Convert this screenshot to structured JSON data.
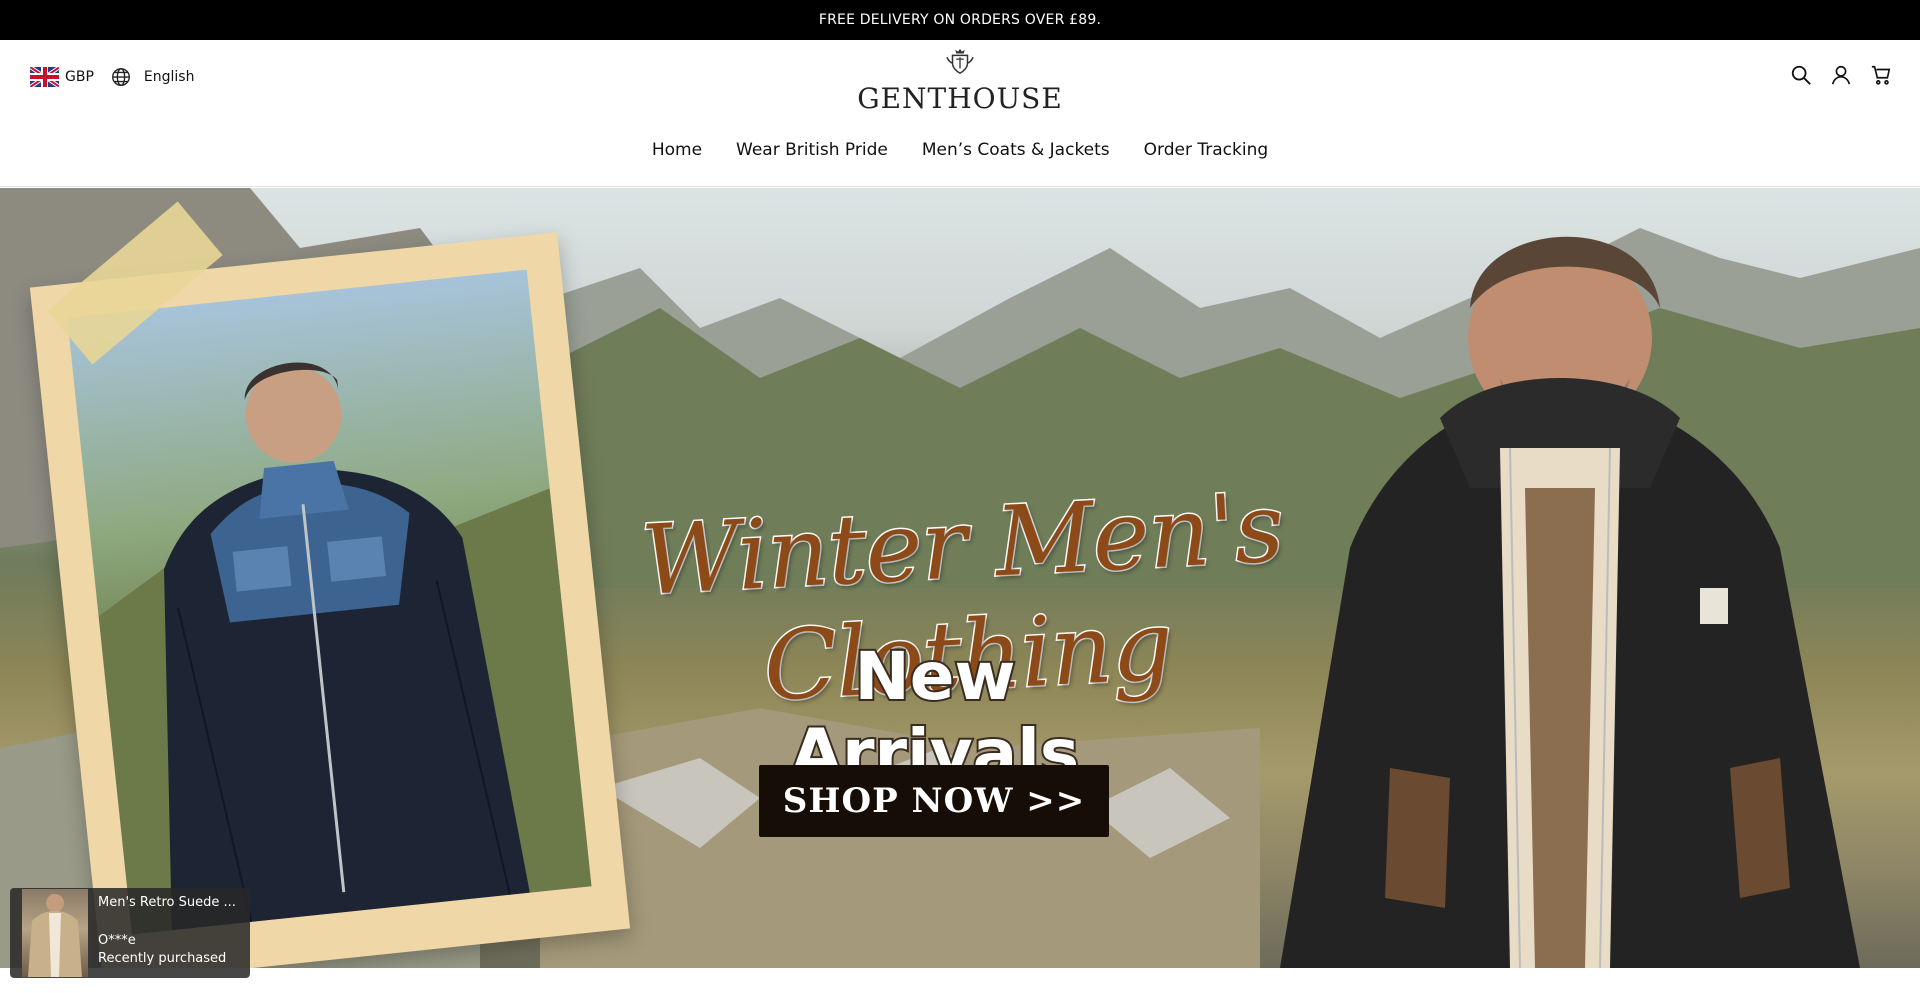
{
  "announcement": {
    "text": "FREE DELIVERY ON ORDERS OVER £89."
  },
  "locale": {
    "currency": "GBP",
    "language": "English"
  },
  "brand": {
    "name": "GENTHOUSE"
  },
  "nav": {
    "items": [
      {
        "label": "Home"
      },
      {
        "label": "Wear British Pride"
      },
      {
        "label": "Men’s Coats & Jackets"
      },
      {
        "label": "Order Tracking"
      }
    ]
  },
  "icons": {
    "flag": "uk-flag-icon",
    "globe": "globe-icon",
    "search": "search-icon",
    "account": "user-icon",
    "cart": "cart-icon",
    "crest": "crest-icon"
  },
  "hero": {
    "headline": "Winter Men's Clothing",
    "subheadline": "New  Arrivals",
    "cta": "SHOP NOW >>"
  },
  "toast": {
    "product": "Men's Retro Suede ...",
    "buyer": "O***e",
    "status": "Recently purchased"
  },
  "colors": {
    "announcement_bg": "#000000",
    "headline": "#8b4a17",
    "cta_bg": "#160d07"
  }
}
